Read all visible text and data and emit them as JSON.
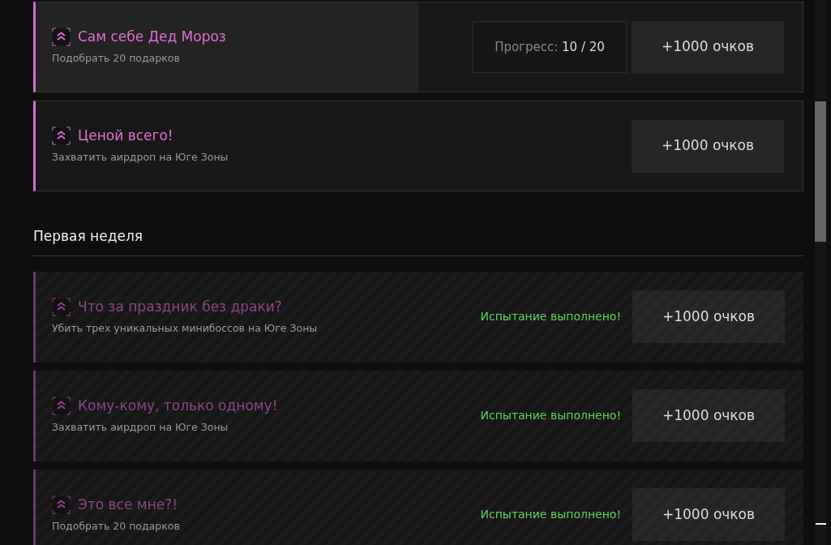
{
  "items": [
    {
      "kind": "challenge",
      "title": "Сам себе Дед Мороз",
      "description": "Подобрать 20 подарков",
      "highlighted": true,
      "completed": false,
      "progress": {
        "label": "Прогресс:",
        "value": "10 / 20"
      },
      "reward": "+1000 очков"
    },
    {
      "kind": "challenge",
      "title": "Ценой всего!",
      "description": "Захватить аирдроп на Юге Зоны",
      "highlighted": false,
      "completed": false,
      "reward": "+1000 очков"
    },
    {
      "kind": "heading",
      "title": "Первая неделя"
    },
    {
      "kind": "challenge",
      "title": "Что за праздник без драки?",
      "description": "Убить трех уникальных минибоссов на Юге Зоны",
      "highlighted": false,
      "completed": true,
      "status": "Испытание выполнено!",
      "reward": "+1000 очков"
    },
    {
      "kind": "challenge",
      "title": "Кому-кому, только одному!",
      "description": "Захватить аирдроп на Юге Зоны",
      "highlighted": false,
      "completed": true,
      "status": "Испытание выполнено!",
      "reward": "+1000 очков"
    },
    {
      "kind": "challenge",
      "title": "Это все мне?!",
      "description": "Подобрать 20 подарков",
      "highlighted": false,
      "completed": true,
      "status": "Испытание выполнено!",
      "reward": "+1000 очков"
    }
  ]
}
